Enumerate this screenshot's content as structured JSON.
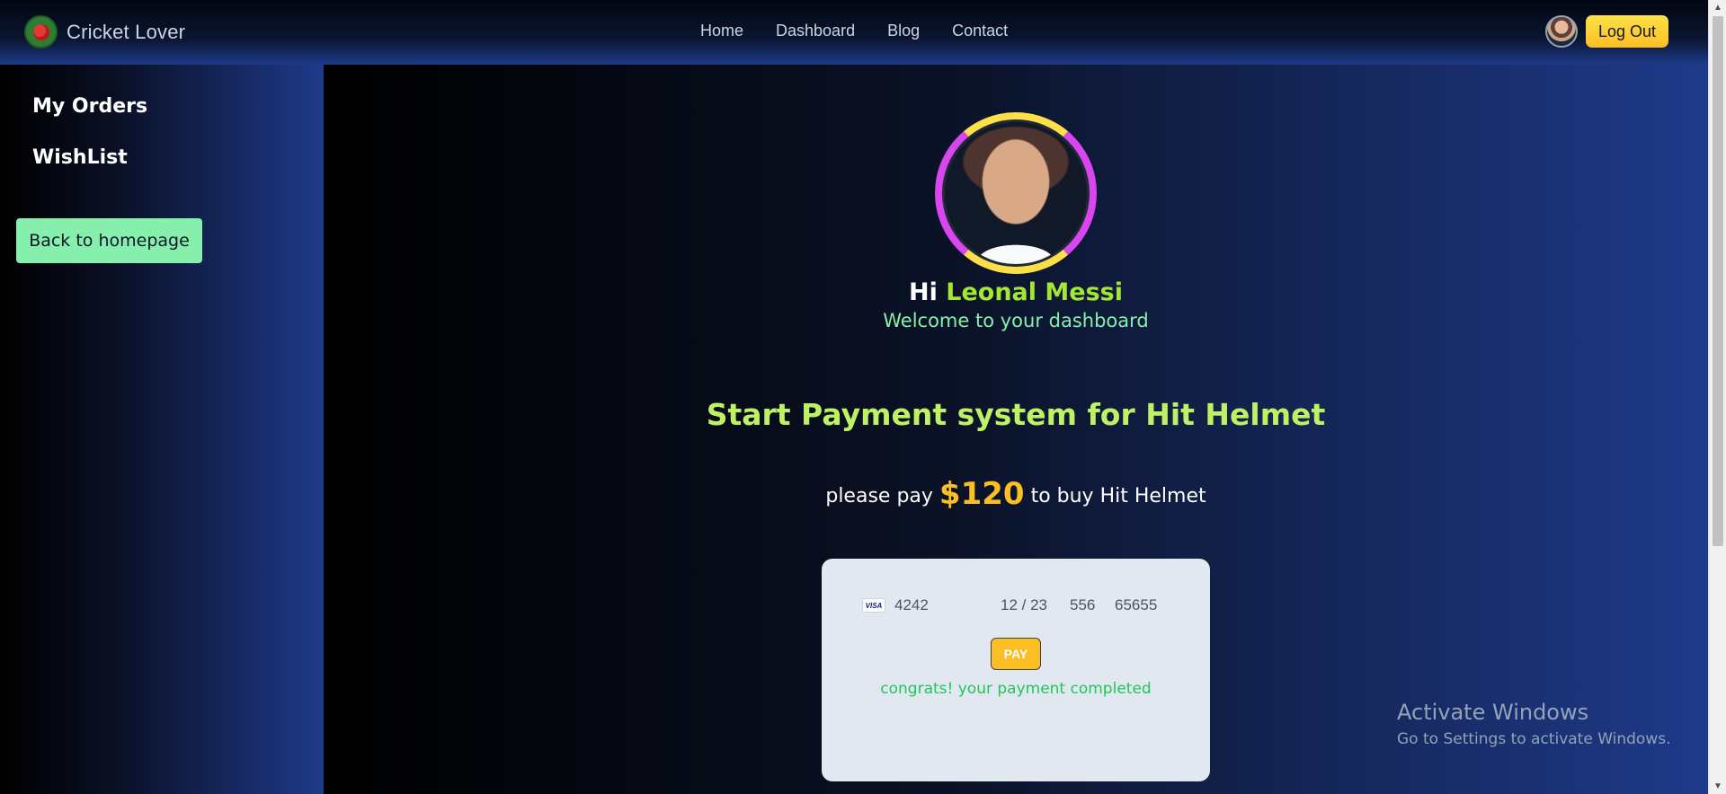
{
  "navbar": {
    "brand": "Cricket Lover",
    "links": [
      "Home",
      "Dashboard",
      "Blog",
      "Contact"
    ],
    "logout_label": "Log Out"
  },
  "sidebar": {
    "items": [
      "My Orders",
      "WishList"
    ],
    "back_button": "Back to homepage"
  },
  "profile": {
    "greeting_prefix": "Hi",
    "name": "Leonal Messi",
    "welcome": "Welcome to your dashboard"
  },
  "payment": {
    "title": "Start Payment system for Hit Helmet",
    "pay_prefix": "please pay",
    "amount": "$120",
    "pay_suffix": "to buy Hit Helmet",
    "card": {
      "brand": "VISA",
      "number": "4242",
      "expiry": "12 / 23",
      "cvc": "556",
      "zip": "65655"
    },
    "pay_button": "PAY",
    "success": "congrats! your payment completed"
  },
  "watermark": {
    "title": "Activate Windows",
    "subtitle": "Go to Settings to activate Windows."
  },
  "colors": {
    "accent_green": "#a3e635",
    "amount_gold": "#fbbf24",
    "success_green": "#22c55e",
    "back_button_bg": "#86efac"
  }
}
